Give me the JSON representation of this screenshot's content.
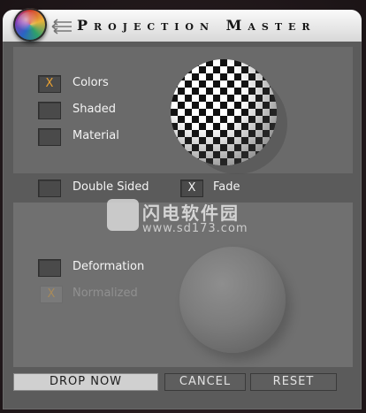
{
  "window": {
    "title": "Projection Master"
  },
  "options": {
    "colors": {
      "label": "Colors",
      "mark": "X"
    },
    "shaded": {
      "label": "Shaded",
      "mark": ""
    },
    "material": {
      "label": "Material",
      "mark": ""
    },
    "double_sided": {
      "label": "Double Sided",
      "mark": ""
    },
    "fade": {
      "label": "Fade",
      "mark": "X"
    },
    "deformation": {
      "label": "Deformation",
      "mark": ""
    },
    "normalized": {
      "label": "Normalized",
      "mark": "X"
    }
  },
  "buttons": {
    "drop_now": "DROP NOW",
    "cancel": "CANCEL",
    "reset": "RESET"
  },
  "watermark": {
    "text": "闪电软件园",
    "url": "www.sd173.com"
  },
  "colors": {
    "accent_mark": "#e8a032",
    "window_bg": "#5b5b5b",
    "title_bar": "#e6e6e6"
  }
}
